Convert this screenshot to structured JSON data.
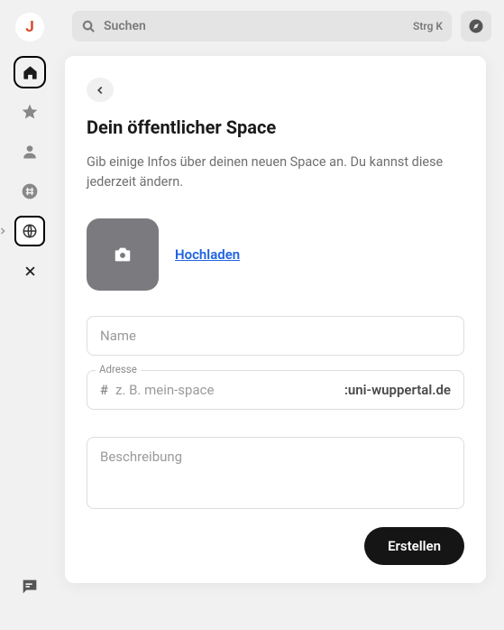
{
  "avatar_letter": "J",
  "search": {
    "placeholder": "Suchen",
    "shortcut": "Strg K"
  },
  "modal": {
    "title": "Dein öffentlicher Space",
    "description": "Gib einige Infos über deinen neuen Space an. Du kannst diese jederzeit ändern.",
    "upload_label": "Hochladen",
    "name_placeholder": "Name",
    "address_label": "Adresse",
    "address_hash": "#",
    "address_placeholder": "z. B. mein-space",
    "address_suffix": ":uni-wuppertal.de",
    "description_placeholder": "Beschreibung",
    "submit_label": "Erstellen"
  }
}
